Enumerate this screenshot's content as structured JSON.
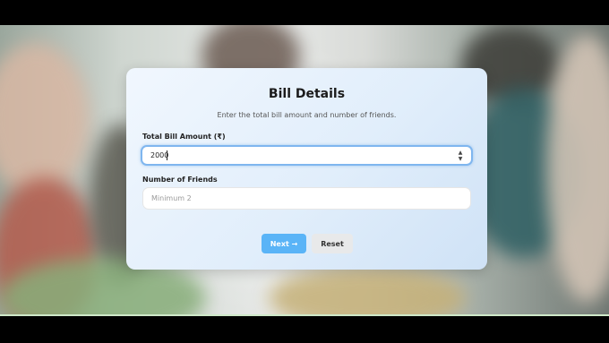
{
  "form": {
    "title": "Bill Details",
    "subtitle": "Enter the total bill amount and number of friends.",
    "amount_label": "Total Bill Amount (₹)",
    "amount_value": "2000",
    "friends_label": "Number of Friends",
    "friends_placeholder": "Minimum 2",
    "next_label": "Next →",
    "reset_label": "Reset"
  },
  "colors": {
    "accent": "#5ab4f7",
    "focus_border": "#7fb6ef",
    "reset_bg": "#e8e9ea"
  }
}
